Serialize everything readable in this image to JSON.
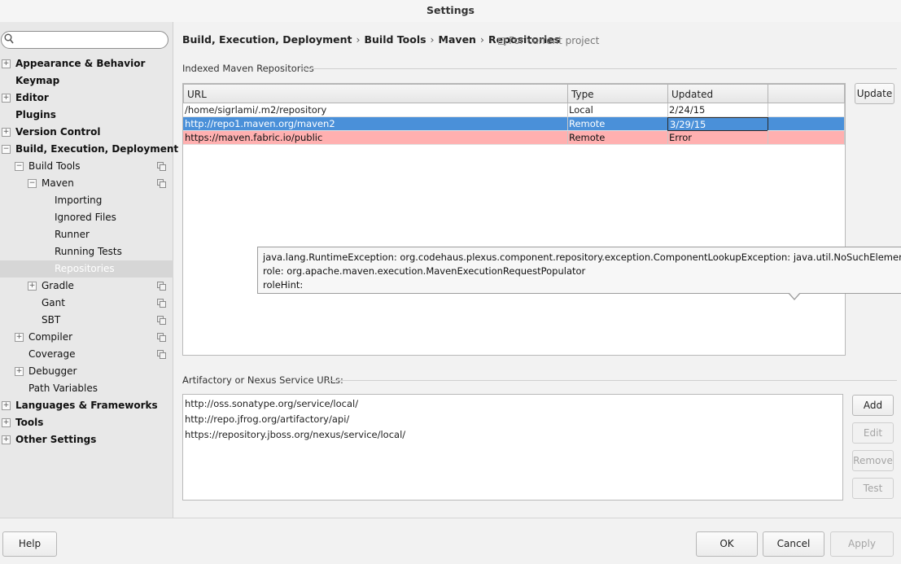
{
  "window": {
    "title": "Settings"
  },
  "search": {
    "placeholder": "",
    "value": ""
  },
  "tree": [
    {
      "label": "Appearance & Behavior",
      "level": 0,
      "bold": true,
      "expander": "+",
      "config": false
    },
    {
      "label": "Keymap",
      "level": 0,
      "bold": true,
      "expander": "",
      "config": false
    },
    {
      "label": "Editor",
      "level": 0,
      "bold": true,
      "expander": "+",
      "config": false
    },
    {
      "label": "Plugins",
      "level": 0,
      "bold": true,
      "expander": "",
      "config": false
    },
    {
      "label": "Version Control",
      "level": 0,
      "bold": true,
      "expander": "+",
      "config": false
    },
    {
      "label": "Build, Execution, Deployment",
      "level": 0,
      "bold": true,
      "expander": "−",
      "config": false
    },
    {
      "label": "Build Tools",
      "level": 1,
      "bold": false,
      "expander": "−",
      "config": true
    },
    {
      "label": "Maven",
      "level": 2,
      "bold": false,
      "expander": "−",
      "config": true
    },
    {
      "label": "Importing",
      "level": 3,
      "bold": false,
      "expander": "",
      "config": false
    },
    {
      "label": "Ignored Files",
      "level": 3,
      "bold": false,
      "expander": "",
      "config": false
    },
    {
      "label": "Runner",
      "level": 3,
      "bold": false,
      "expander": "",
      "config": false
    },
    {
      "label": "Running Tests",
      "level": 3,
      "bold": false,
      "expander": "",
      "config": false
    },
    {
      "label": "Repositories",
      "level": 3,
      "bold": false,
      "expander": "",
      "config": false,
      "selected": true
    },
    {
      "label": "Gradle",
      "level": 2,
      "bold": false,
      "expander": "+",
      "config": true
    },
    {
      "label": "Gant",
      "level": 2,
      "bold": false,
      "expander": "",
      "config": true
    },
    {
      "label": "SBT",
      "level": 2,
      "bold": false,
      "expander": "",
      "config": true
    },
    {
      "label": "Compiler",
      "level": 1,
      "bold": false,
      "expander": "+",
      "config": true
    },
    {
      "label": "Coverage",
      "level": 1,
      "bold": false,
      "expander": "",
      "config": true
    },
    {
      "label": "Debugger",
      "level": 1,
      "bold": false,
      "expander": "+",
      "config": false
    },
    {
      "label": "Path Variables",
      "level": 1,
      "bold": false,
      "expander": "",
      "config": false
    },
    {
      "label": "Languages & Frameworks",
      "level": 0,
      "bold": true,
      "expander": "+",
      "config": false
    },
    {
      "label": "Tools",
      "level": 0,
      "bold": true,
      "expander": "+",
      "config": false
    },
    {
      "label": "Other Settings",
      "level": 0,
      "bold": true,
      "expander": "+",
      "config": false
    }
  ],
  "breadcrumb": [
    "Build, Execution, Deployment",
    "Build Tools",
    "Maven",
    "Repositories"
  ],
  "breadcrumb_sep": "›",
  "scope_label": "For current project",
  "indexed": {
    "title": "Indexed Maven Repositories",
    "columns": [
      "URL",
      "Type",
      "Updated",
      ""
    ],
    "rows": [
      {
        "url": "/home/sigrlami/.m2/repository",
        "type": "Local",
        "updated": "2/24/15",
        "state": "normal"
      },
      {
        "url": "http://repo1.maven.org/maven2",
        "type": "Remote",
        "updated": "3/29/15",
        "state": "selected"
      },
      {
        "url": "https://maven.fabric.io/public",
        "type": "Remote",
        "updated": "Error",
        "state": "error"
      }
    ],
    "update_button": "Update"
  },
  "tooltip": {
    "lines": [
      "java.lang.RuntimeException: org.codehaus.plexus.component.repository.exception.ComponentLookupException: java.util.NoSuchElementException",
      "role: org.apache.maven.execution.MavenExecutionRequestPopulator",
      "roleHint:"
    ]
  },
  "services": {
    "title": "Artifactory or Nexus Service URLs:",
    "urls": [
      "http://oss.sonatype.org/service/local/",
      "http://repo.jfrog.org/artifactory/api/",
      "https://repository.jboss.org/nexus/service/local/"
    ],
    "buttons": {
      "add": "Add",
      "edit": "Edit",
      "remove": "Remove",
      "test": "Test"
    }
  },
  "footer": {
    "help": "Help",
    "ok": "OK",
    "cancel": "Cancel",
    "apply": "Apply"
  }
}
